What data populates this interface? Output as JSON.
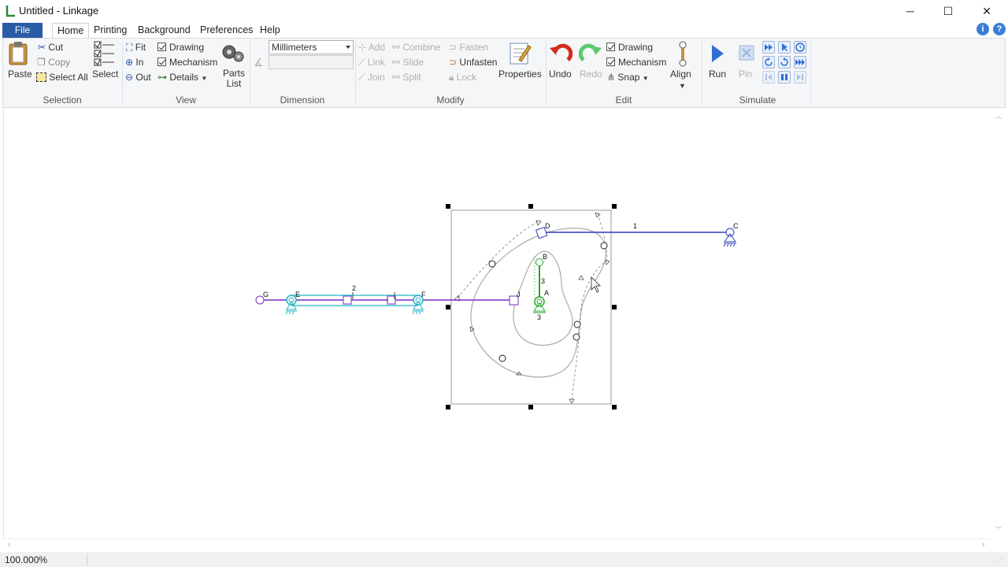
{
  "window": {
    "title": "Untitled - Linkage",
    "minimize": "─",
    "maximize": "☐",
    "close": "✕"
  },
  "menu": {
    "file": "File",
    "tabs": [
      "Home",
      "Printing",
      "Background",
      "Preferences",
      "Help"
    ]
  },
  "ribbon": {
    "selection": {
      "label": "Selection",
      "paste": "Paste",
      "cut": "Cut",
      "copy": "Copy",
      "select_all": "Select All",
      "select": "Select"
    },
    "view": {
      "label": "View",
      "fit": "Fit",
      "in": "In",
      "out": "Out",
      "drawing": "Drawing",
      "mechanism": "Mechanism",
      "details": "Details",
      "parts_list_1": "Parts",
      "parts_list_2": "List"
    },
    "dimension": {
      "label": "Dimension",
      "units": "Millimeters"
    },
    "modify": {
      "label": "Modify",
      "add": "Add",
      "link": "Link",
      "join": "Join",
      "combine": "Combine",
      "slide": "Slide",
      "split": "Split",
      "fasten": "Fasten",
      "unfasten": "Unfasten",
      "lock": "Lock",
      "properties": "Properties"
    },
    "edit": {
      "label": "Edit",
      "undo": "Undo",
      "redo": "Redo",
      "drawing": "Drawing",
      "mechanism": "Mechanism",
      "snap": "Snap",
      "align": "Align"
    },
    "simulate": {
      "label": "Simulate",
      "run": "Run",
      "pin": "Pin"
    }
  },
  "canvas": {
    "link_labels": [
      "1",
      "2",
      "3",
      "3"
    ],
    "joint_labels": [
      "A",
      "B",
      "C",
      "D",
      "E",
      "F",
      "G",
      "I",
      "J"
    ]
  },
  "status": {
    "zoom": "100.000%"
  },
  "colors": {
    "blue_link": "#2f3fb8",
    "teal_link": "#22b3c4",
    "purple_link": "#7b2fc4",
    "green_link": "#2aa52a",
    "undo_red": "#d42b1e",
    "redo_green": "#5bc86f",
    "file_blue": "#2a5ba5"
  }
}
